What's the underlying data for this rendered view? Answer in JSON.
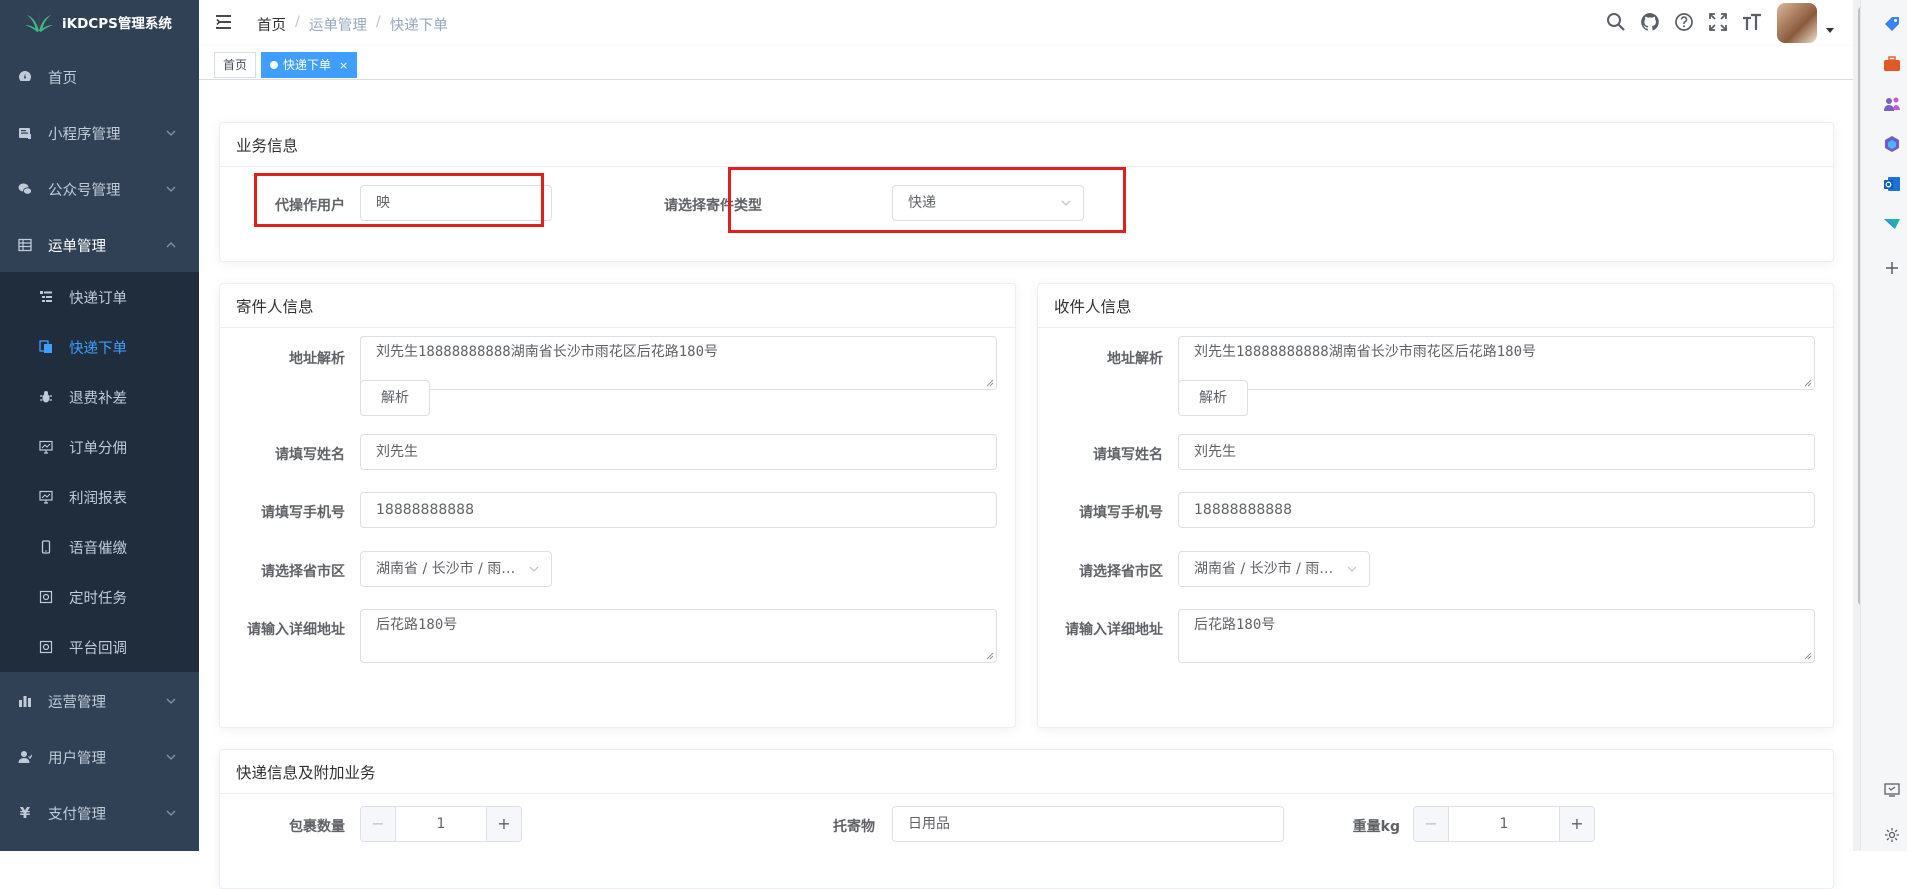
{
  "app": {
    "title": "iKDCPS管理系统"
  },
  "sidebar": {
    "items": [
      {
        "label": "首页",
        "icon": "dashboard-icon"
      },
      {
        "label": "小程序管理",
        "icon": "miniprogram-icon"
      },
      {
        "label": "公众号管理",
        "icon": "wechat-icon"
      },
      {
        "label": "运单管理",
        "icon": "table-icon"
      },
      {
        "label": "运营管理",
        "icon": "chart-icon"
      },
      {
        "label": "用户管理",
        "icon": "user-icon"
      },
      {
        "label": "支付管理",
        "icon": "yen-icon"
      }
    ],
    "sub_items": [
      {
        "label": "快递订单",
        "icon": "list-icon"
      },
      {
        "label": "快递下单",
        "icon": "documents-icon"
      },
      {
        "label": "退费补差",
        "icon": "bug-icon"
      },
      {
        "label": "订单分佣",
        "icon": "monitor-icon"
      },
      {
        "label": "利润报表",
        "icon": "monitor-icon"
      },
      {
        "label": "语音催缴",
        "icon": "phone-icon"
      },
      {
        "label": "定时任务",
        "icon": "job-icon"
      },
      {
        "label": "平台回调",
        "icon": "job-icon"
      }
    ]
  },
  "breadcrumb": {
    "home": "首页",
    "level1": "运单管理",
    "level2": "快递下单",
    "sep": "/"
  },
  "tags": {
    "home": "首页",
    "active": "快递下单",
    "close": "×"
  },
  "business": {
    "title": "业务信息",
    "operator_label": "代操作用户",
    "operator_value": "映",
    "type_label": "请选择寄件类型",
    "type_value": "快递"
  },
  "sender": {
    "title": "寄件人信息",
    "parse_label": "地址解析",
    "parse_value": "刘先生18888888888湖南省长沙市雨花区后花路180号",
    "parse_button": "解析",
    "name_label": "请填写姓名",
    "name_value": "刘先生",
    "phone_label": "请填写手机号",
    "phone_value": "18888888888",
    "region_label": "请选择省市区",
    "region_value": "湖南省 / 长沙市 / 雨…",
    "detail_label": "请输入详细地址",
    "detail_value": "后花路180号"
  },
  "receiver": {
    "title": "收件人信息",
    "parse_label": "地址解析",
    "parse_value": "刘先生18888888888湖南省长沙市雨花区后花路180号",
    "parse_button": "解析",
    "name_label": "请填写姓名",
    "name_value": "刘先生",
    "phone_label": "请填写手机号",
    "phone_value": "18888888888",
    "region_label": "请选择省市区",
    "region_value": "湖南省 / 长沙市 / 雨…",
    "detail_label": "请输入详细地址",
    "detail_value": "后花路180号"
  },
  "express": {
    "title": "快递信息及附加业务",
    "count_label": "包裹数量",
    "count_value": "1",
    "goods_label": "托寄物",
    "goods_value": "日用品",
    "weight_label": "重量kg",
    "weight_value": "1",
    "minus": "−",
    "plus": "+"
  },
  "colors": {
    "sidebar_bg": "#304156",
    "submenu_bg": "#1f2d3d",
    "accent": "#409eff",
    "highlight_box": "#e0201c"
  }
}
